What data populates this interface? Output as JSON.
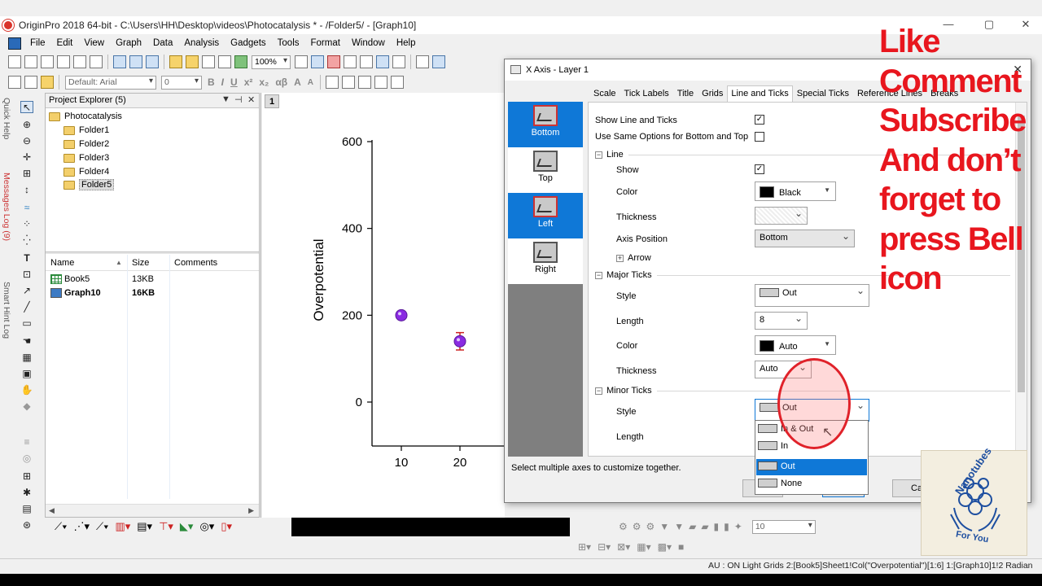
{
  "window": {
    "title": "OriginPro 2018 64-bit - C:\\Users\\HH\\Desktop\\videos\\Photocatalysis * - /Folder5/ - [Graph10]",
    "min": "—",
    "max": "▢",
    "close": "✕"
  },
  "menu": [
    "File",
    "Edit",
    "View",
    "Graph",
    "Data",
    "Analysis",
    "Gadgets",
    "Tools",
    "Format",
    "Window",
    "Help"
  ],
  "toolbar": {
    "zoom": "100%",
    "font": "Default: Arial",
    "size": "0",
    "bold": "B",
    "italic": "I",
    "underline": "U",
    "superscript": "x²",
    "subscript": "x₂",
    "greek": "αβ",
    "fontup": "A",
    "fontdown": "A"
  },
  "side_tabs": [
    "Quick Help",
    "Messages Log (9)",
    "Smart Hint Log"
  ],
  "project_explorer": {
    "title": "Project Explorer (5)",
    "root": "Photocatalysis",
    "folders": [
      "Folder1",
      "Folder2",
      "Folder3",
      "Folder4",
      "Folder5"
    ],
    "selected_folder": "Folder5",
    "columns": [
      "Name",
      "Size",
      "Comments"
    ],
    "files": [
      {
        "name": "Book5",
        "size": "13KB"
      },
      {
        "name": "Graph10",
        "size": "16KB"
      }
    ]
  },
  "graph": {
    "page": "1",
    "ylabel": "Overpotential",
    "y_ticks": [
      "600",
      "400",
      "200",
      "0"
    ],
    "x_ticks": [
      "10",
      "20"
    ],
    "points": [
      {
        "x": 10,
        "y": 200,
        "err": 0
      },
      {
        "x": 20,
        "y": 140,
        "err": 20
      }
    ],
    "point_color": "#8a2be2"
  },
  "dialog": {
    "title": "X Axis - Layer 1",
    "close": "✕",
    "tabs": [
      "Scale",
      "Tick Labels",
      "Title",
      "Grids",
      "Line and Ticks",
      "Special Ticks",
      "Reference Lines",
      "Breaks"
    ],
    "active_tab": "Line and Ticks",
    "axes": [
      "Bottom",
      "Top",
      "Left",
      "Right"
    ],
    "show_line_and_ticks": "Show Line and Ticks",
    "use_same": "Use Same Options for Bottom and Top",
    "line": {
      "group": "Line",
      "show": "Show",
      "color_label": "Color",
      "color_value": "Black",
      "thickness_label": "Thickness",
      "axis_position_label": "Axis Position",
      "axis_position_value": "Bottom",
      "arrow": "Arrow"
    },
    "major": {
      "group": "Major Ticks",
      "style_label": "Style",
      "style_value": "Out",
      "length_label": "Length",
      "length_value": "8",
      "color_label": "Color",
      "color_value": "Auto",
      "thickness_label": "Thickness",
      "thickness_value": "Auto"
    },
    "minor": {
      "group": "Minor Ticks",
      "style_label": "Style",
      "style_value": "Out",
      "length_label": "Length"
    },
    "status": "Select multiple axes to customize together.",
    "buttons": {
      "cancel": "Ca"
    },
    "dropdown_options": [
      "In & Out",
      "In",
      "Out",
      "None"
    ],
    "dropdown_selected": "Out"
  },
  "bottom_toolbar": {
    "size": "10"
  },
  "statusbar": "AU : ON  Light Grids  2:[Book5]Sheet1!Col(\"Overpotential\")[1:6]  1:[Graph10]1!2  Radian",
  "overlay": {
    "lines": [
      "Like",
      "Comment",
      "Subscribe",
      "And don’t",
      "forget to",
      "press Bell",
      "icon"
    ],
    "color": "#e8161e"
  },
  "logo": {
    "top": "Nanotubes",
    "bottom": "For You"
  }
}
